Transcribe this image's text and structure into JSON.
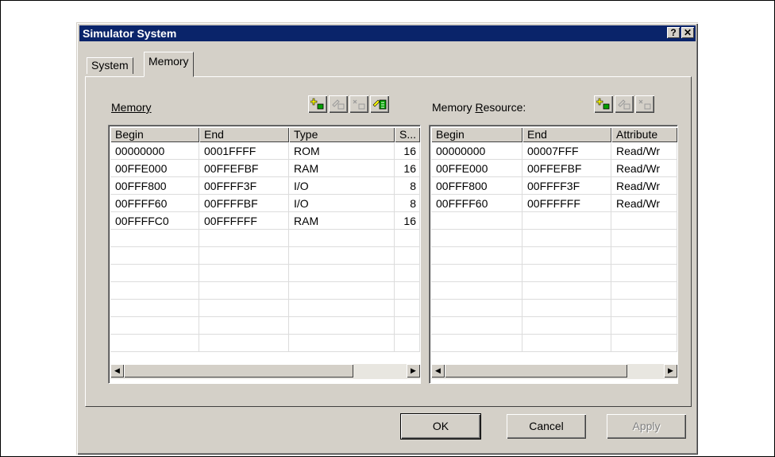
{
  "dialog": {
    "title": "Simulator System",
    "help_button": "?",
    "close_button": "✕"
  },
  "tabs": [
    {
      "label": "System",
      "active": false
    },
    {
      "label": "Memory",
      "active": true
    }
  ],
  "memory": {
    "label": "Memory",
    "toolbar": [
      "add-icon",
      "edit-icon",
      "delete-icon",
      "import-icon"
    ],
    "columns": [
      "Begin",
      "End",
      "Type",
      "S..."
    ],
    "rows": [
      [
        "00000000",
        "0001FFFF",
        "ROM",
        "16"
      ],
      [
        "00FFE000",
        "00FFEFBF",
        "RAM",
        "16"
      ],
      [
        "00FFF800",
        "00FFFF3F",
        "I/O",
        "8"
      ],
      [
        "00FFFF60",
        "00FFFFBF",
        "I/O",
        "8"
      ],
      [
        "00FFFFC0",
        "00FFFFFF",
        "RAM",
        "16"
      ]
    ]
  },
  "memory_resource": {
    "label_prefix": "Memory ",
    "label_underlined": "R",
    "label_suffix": "esource:",
    "toolbar": [
      "add-icon",
      "edit-icon",
      "delete-icon"
    ],
    "columns": [
      "Begin",
      "End",
      "Attribute"
    ],
    "rows": [
      [
        "00000000",
        "00007FFF",
        "Read/Wr"
      ],
      [
        "00FFE000",
        "00FFEFBF",
        "Read/Wr"
      ],
      [
        "00FFF800",
        "00FFFF3F",
        "Read/Wr"
      ],
      [
        "00FFFF60",
        "00FFFFFF",
        "Read/Wr"
      ]
    ]
  },
  "buttons": {
    "ok": "OK",
    "cancel": "Cancel",
    "apply": "Apply"
  },
  "colors": {
    "titlebar": "#0a246a",
    "face": "#d4d0c8"
  }
}
